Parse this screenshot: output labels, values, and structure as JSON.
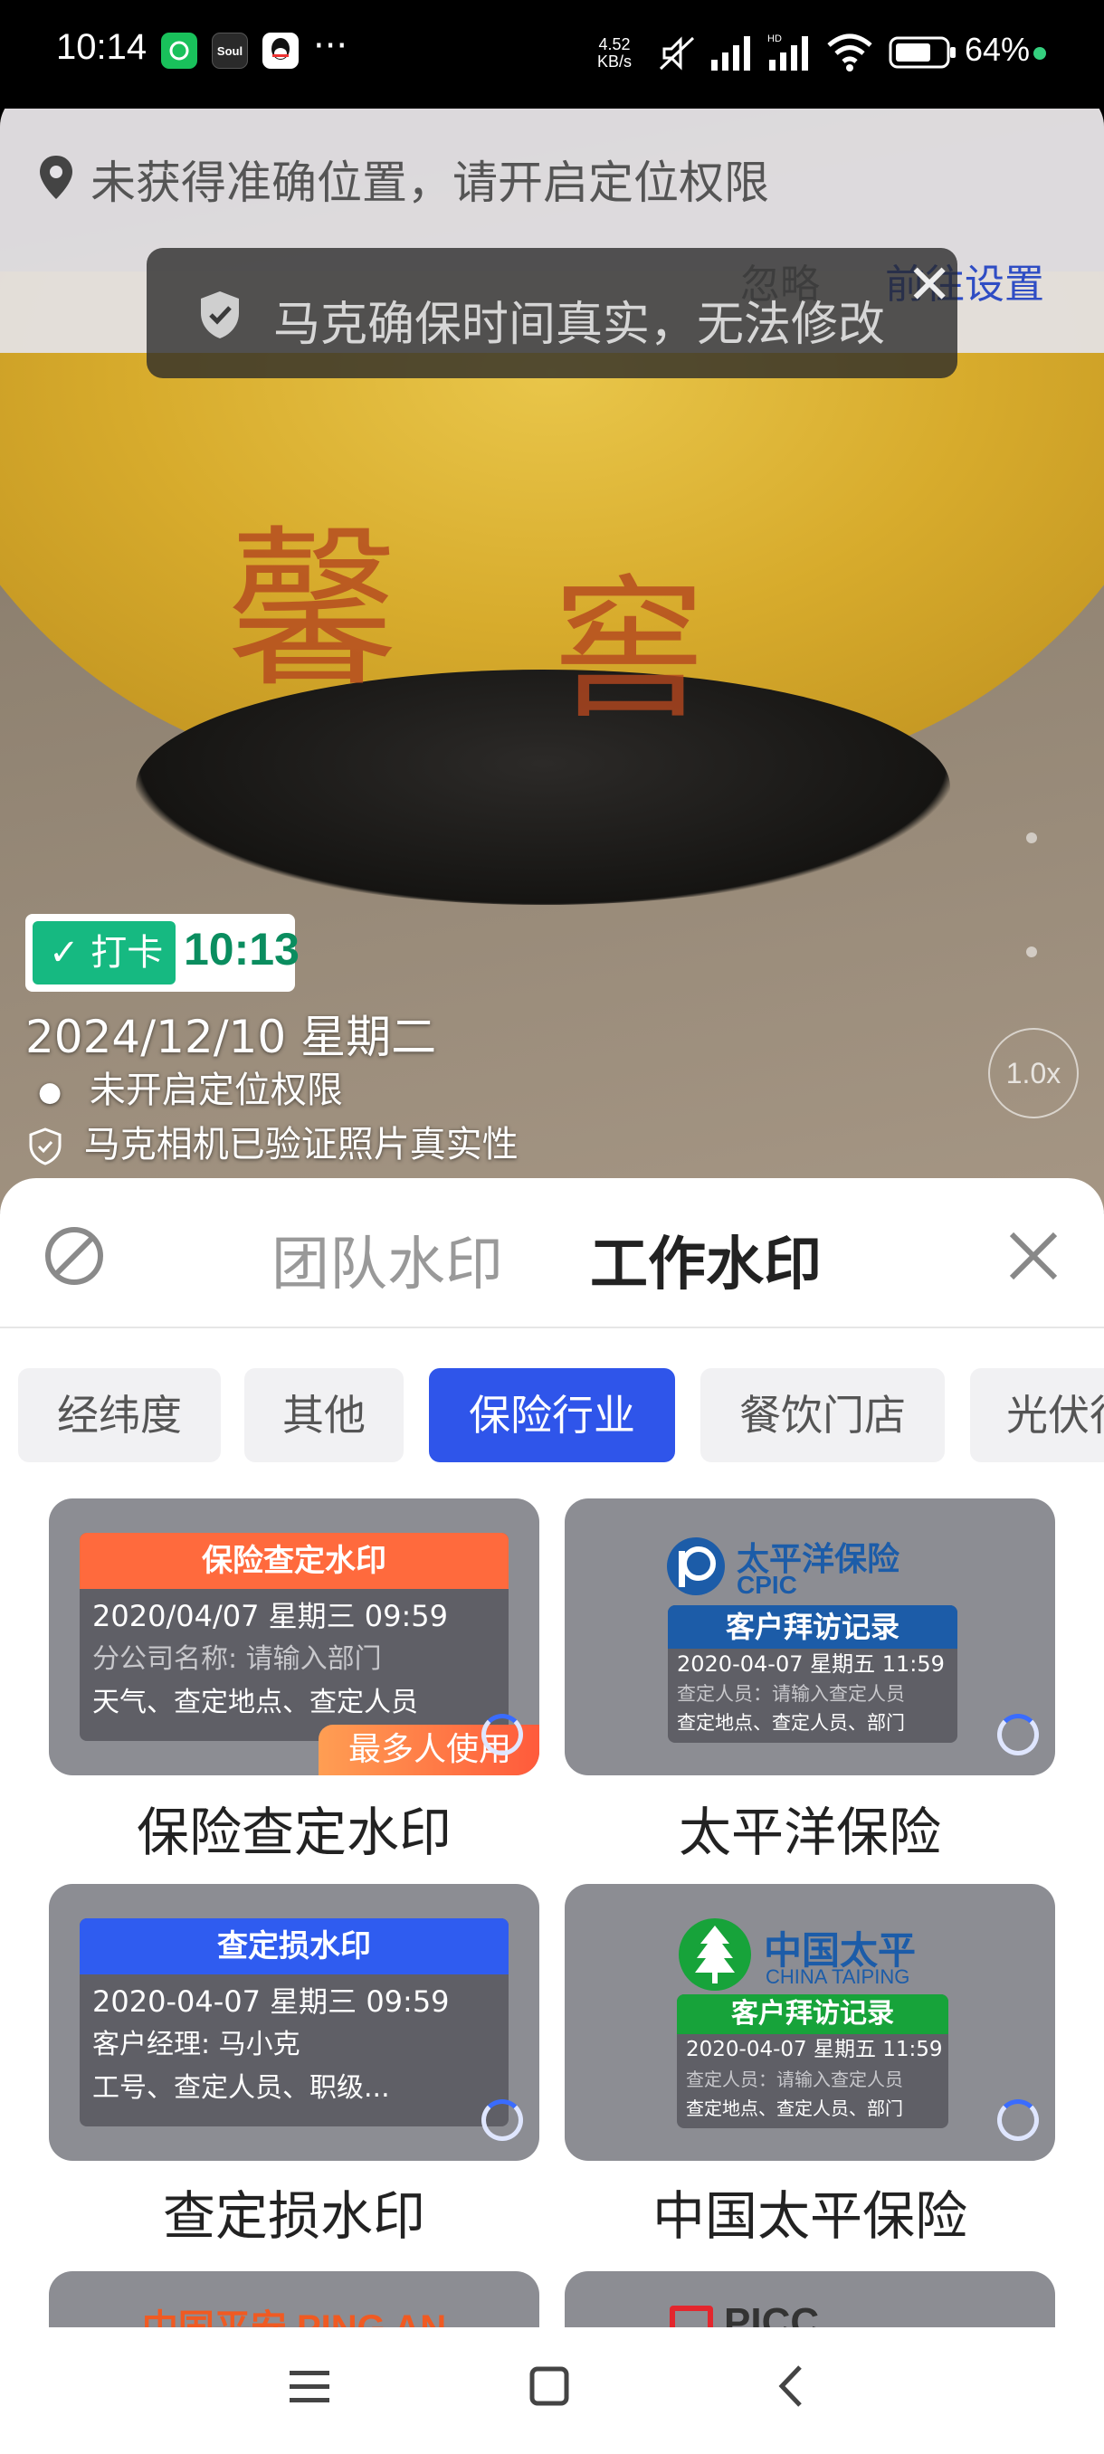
{
  "status_bar": {
    "time": "10:14",
    "apps": [
      {
        "name": "wechat-like-green-app",
        "label": "",
        "color": "#19c15b"
      },
      {
        "name": "soul-app",
        "label": "Soul",
        "color": "#222222"
      },
      {
        "name": "qq-app",
        "label": "",
        "color": "#ffffff"
      }
    ],
    "more": "···",
    "net_speed_value": "4.52",
    "net_speed_unit": "KB/s",
    "battery": "64%"
  },
  "location_banner": {
    "text": "未获得准确位置，请开启定位权限",
    "ignore_label": "忽略",
    "settings_label": "前往设置"
  },
  "toast": {
    "text": "马克确保时间真实，无法修改"
  },
  "watermark": {
    "checkin_label": "打卡",
    "time": "10:13",
    "date_line": "2024/12/10  星期二",
    "location_line": "未开启定位权限",
    "verified_line": "马克相机已验证照片真实性"
  },
  "camera": {
    "zoom": "1.0x"
  },
  "sheet": {
    "tabs": [
      {
        "label": "团队水印",
        "active": false
      },
      {
        "label": "工作水印",
        "active": true
      }
    ],
    "categories": [
      {
        "label": "经纬度",
        "active": false
      },
      {
        "label": "其他",
        "active": false
      },
      {
        "label": "保险行业",
        "active": true
      },
      {
        "label": "餐饮门店",
        "active": false
      },
      {
        "label": "光伏行",
        "active": false
      }
    ],
    "templates": [
      {
        "title": "保险查定水印",
        "header": "保险查定水印",
        "header_color": "#ff6a3d",
        "rows": [
          "2020/04/07 星期三 09:59",
          "分公司名称: 请输入部门",
          "天气、查定地点、查定人员"
        ],
        "badge": "最多人使用"
      },
      {
        "title": "太平洋保险",
        "logo_cn": "太平洋保险",
        "logo_en": "CPIC",
        "header": "客户拜访记录",
        "header_color": "#1c5ca8",
        "rows": [
          "2020-04-07 星期五 11:59",
          "查定人员：请输入查定人员",
          "查定地点、查定人员、部门"
        ]
      },
      {
        "title": "查定损水印",
        "header": "查定损水印",
        "header_color": "#2f5cf0",
        "rows": [
          "2020-04-07 星期三 09:59",
          "客户经理: 马小克",
          "工号、查定人员、职级..."
        ]
      },
      {
        "title": "中国太平保险",
        "logo_cn": "中国太平",
        "logo_en": "CHINA TAIPING",
        "header": "客户拜访记录",
        "header_color": "#17a33a",
        "rows": [
          "2020-04-07 星期五 11:59",
          "查定人员：请输入查定人员",
          "查定地点、查定人员、部门"
        ]
      },
      {
        "title": "",
        "logo_cn": "中国平安 PING AN"
      },
      {
        "title": "",
        "logo_cn": "PICC"
      }
    ]
  },
  "colors": {
    "accent": "#2f55ea",
    "checkin_green": "#16b981"
  }
}
